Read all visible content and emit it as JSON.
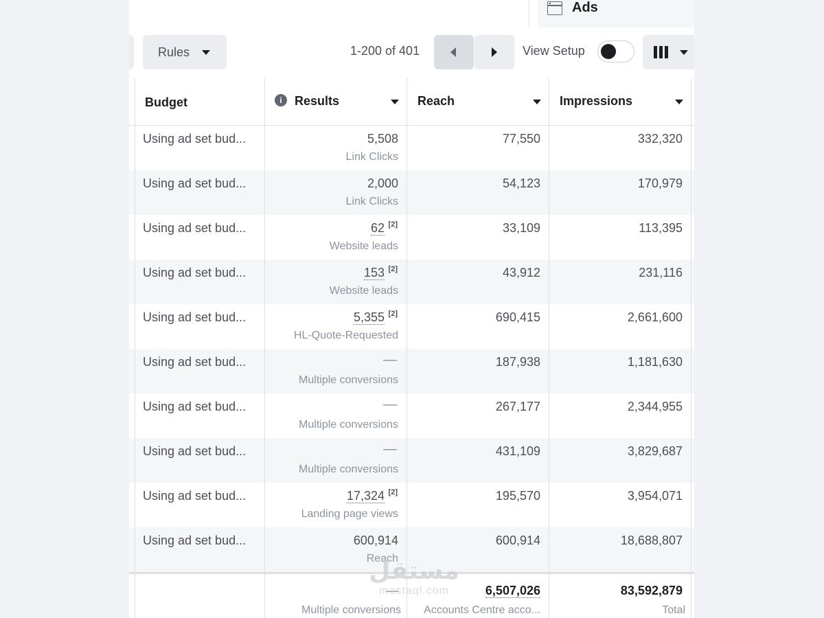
{
  "tab": {
    "label": "Ads",
    "icon": "ad-window-icon"
  },
  "toolbar": {
    "rules_label": "Rules",
    "pagination": "1-200 of 401",
    "view_setup_label": "View Setup",
    "view_setup_on": false,
    "prev_icon": "chevron-left-icon",
    "next_icon": "chevron-right-icon",
    "columns_icon": "columns-icon"
  },
  "columns": {
    "budget": "Budget",
    "results": "Results",
    "reach": "Reach",
    "impressions": "Impressions"
  },
  "rows": [
    {
      "budget": "Using ad set bud...",
      "results": "5,508",
      "results_note": "",
      "results_sub": "Link Clicks",
      "reach": "77,550",
      "impressions": "332,320"
    },
    {
      "budget": "Using ad set bud...",
      "results": "2,000",
      "results_note": "",
      "results_sub": "Link Clicks",
      "reach": "54,123",
      "impressions": "170,979"
    },
    {
      "budget": "Using ad set bud...",
      "results": "62",
      "results_note": "[2]",
      "results_sub": "Website leads",
      "reach": "33,109",
      "impressions": "113,395"
    },
    {
      "budget": "Using ad set bud...",
      "results": "153",
      "results_note": "[2]",
      "results_sub": "Website leads",
      "reach": "43,912",
      "impressions": "231,116"
    },
    {
      "budget": "Using ad set bud...",
      "results": "5,355",
      "results_note": "[2]",
      "results_sub": "HL-Quote-Requested",
      "reach": "690,415",
      "impressions": "2,661,600"
    },
    {
      "budget": "Using ad set bud...",
      "results": "—",
      "results_note": "",
      "results_sub": "Multiple conversions",
      "reach": "187,938",
      "impressions": "1,181,630"
    },
    {
      "budget": "Using ad set bud...",
      "results": "—",
      "results_note": "",
      "results_sub": "Multiple conversions",
      "reach": "267,177",
      "impressions": "2,344,955"
    },
    {
      "budget": "Using ad set bud...",
      "results": "—",
      "results_note": "",
      "results_sub": "Multiple conversions",
      "reach": "431,109",
      "impressions": "3,829,687"
    },
    {
      "budget": "Using ad set bud...",
      "results": "17,324",
      "results_note": "[2]",
      "results_sub": "Landing page views",
      "reach": "195,570",
      "impressions": "3,954,071"
    },
    {
      "budget": "Using ad set bud...",
      "results": "600,914",
      "results_note": "",
      "results_sub": "Reach",
      "reach": "600,914",
      "impressions": "18,688,807"
    }
  ],
  "summary": {
    "results": "—",
    "results_sub": "Multiple conversions",
    "reach": "6,507,026",
    "reach_sub": "Accounts Centre acco...",
    "impressions": "83,592,879",
    "impressions_sub": "Total"
  },
  "watermark": {
    "logo_text": "مستقل",
    "site": "mostaql.com"
  }
}
